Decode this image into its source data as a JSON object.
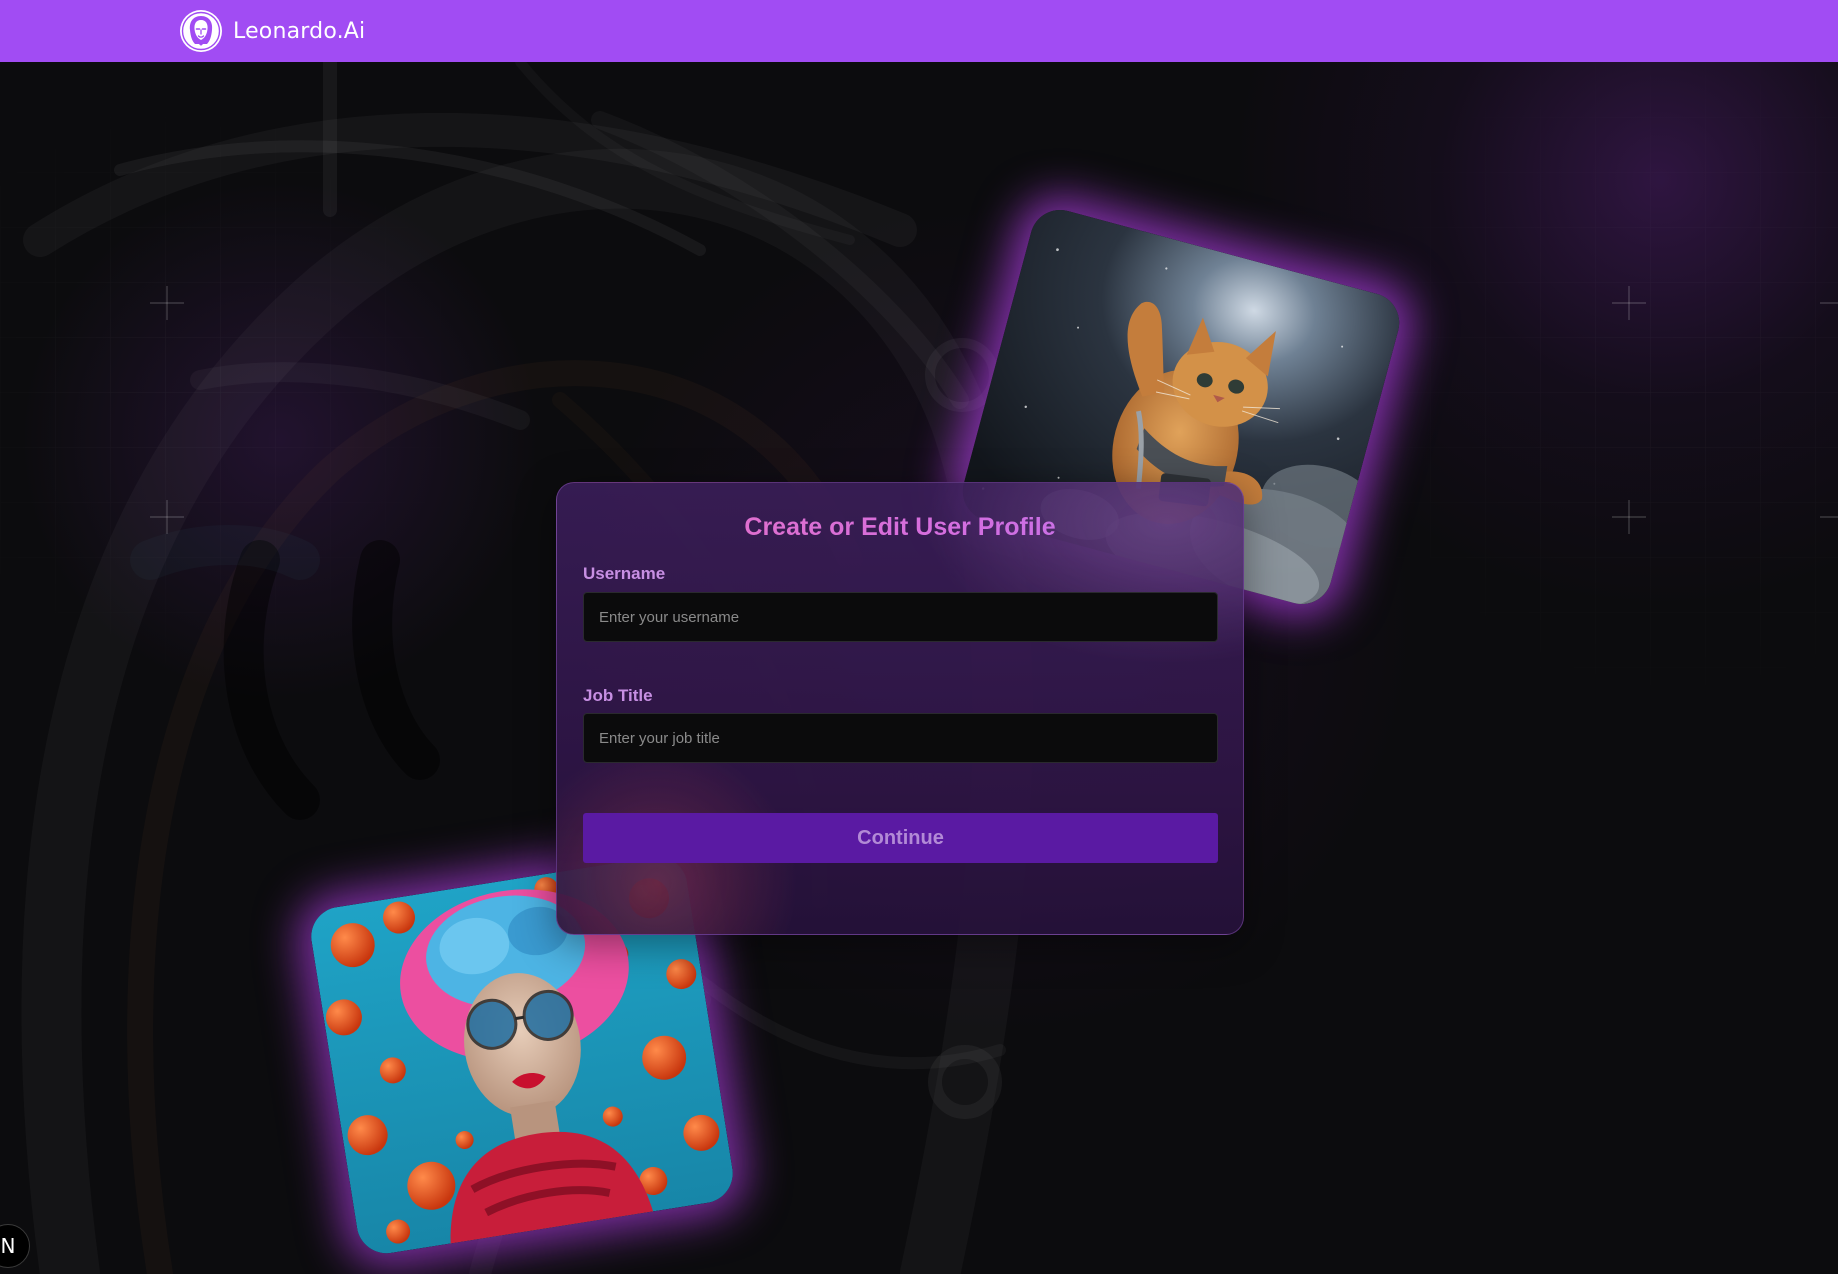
{
  "header": {
    "brand_name": "Leonardo.Ai",
    "logo_icon": "leonardo-logo-icon",
    "background_color": "#a14cf3"
  },
  "form": {
    "title": "Create or Edit User Profile",
    "username_label": "Username",
    "username_placeholder": "Enter your username",
    "username_value": "",
    "job_title_label": "Job Title",
    "job_title_placeholder": "Enter your job title",
    "job_title_value": "",
    "continue_label": "Continue",
    "title_color": "#e46fd0",
    "label_color": "#c78fe3",
    "button_color": "#5a1aa3"
  },
  "images": [
    {
      "subject": "cat-in-space",
      "name": "cat-space-art"
    },
    {
      "subject": "woman-pink-blue-hair",
      "name": "woman-portrait-art"
    }
  ],
  "corner_badge": {
    "label": "N",
    "icon": "nextjs-badge-icon"
  },
  "accent_glow": "#aa3cdc"
}
